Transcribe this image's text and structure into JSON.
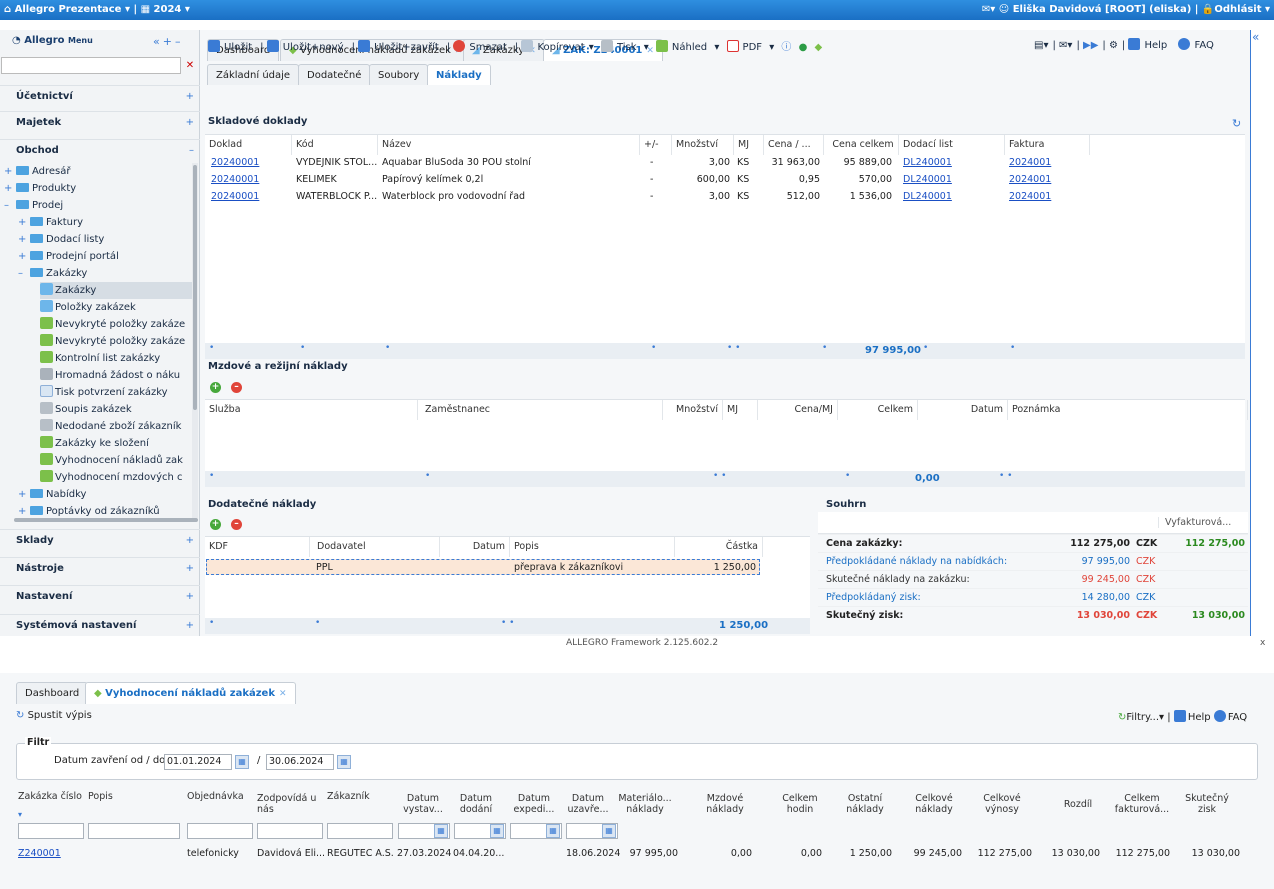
{
  "topbar": {
    "app": "Allegro Prezentace",
    "year": "2024",
    "user": "Eliška Davidová [ROOT] (eliska)",
    "logout": "Odhlásit"
  },
  "sidebar": {
    "title": "Allegro",
    "menu": "Menu",
    "sections": [
      "Účetnictví",
      "Majetek",
      "Obchod",
      "Sklady",
      "Nástroje",
      "Nastavení",
      "Systémová nastavení"
    ],
    "tree": [
      "Adresář",
      "Produkty",
      "Prodej",
      "Faktury",
      "Dodací listy",
      "Prodejní portál",
      "Zakázky",
      "Zakázky",
      "Položky zakázek",
      "Nevykryté položky zakáze",
      "Nevykryté položky zakáze",
      "Kontrolní list zakázky",
      "Hromadná žádost o náku",
      "Tisk potvrzení zakázky",
      "Soupis zakázek",
      "Nedodané zboží zákazník",
      "Zakázky ke složení",
      "Vyhodnocení nákladů zak",
      "Vyhodnocení mzdových c",
      "Nabídky",
      "Poptávky od zákazníků"
    ]
  },
  "tabs": {
    "t1": "Dashboard",
    "t2": "Vyhodnocení nákladů zakázek",
    "t3": "Zakázky",
    "t4": "ZAK: Z240001"
  },
  "toolbar": {
    "save": "Uložit",
    "save_new": "Uložit+nový",
    "save_close": "Uložit+zavřít",
    "delete": "Smazat",
    "copy": "Kopírovat",
    "print": "Tisk",
    "preview": "Náhled",
    "pdf": "PDF",
    "help": "Help",
    "faq": "FAQ"
  },
  "subtabs": [
    "Základní údaje",
    "Dodatečné",
    "Soubory",
    "Náklady"
  ],
  "stock": {
    "title": "Skladové doklady",
    "headers": [
      "Doklad",
      "Kód",
      "Název",
      "+/-",
      "Množství",
      "MJ",
      "Cena / ...",
      "Cena celkem",
      "Dodací list",
      "Faktura"
    ],
    "rows": [
      [
        "20240001",
        "VYDEJNIK STOL...",
        "Aquabar BluSoda 30 POU stolní",
        "-",
        "3,00",
        "KS",
        "31 963,00",
        "95 889,00",
        "DL240001",
        "2024001"
      ],
      [
        "20240001",
        "KELIMEK",
        "Papírový kelímek 0,2l",
        "-",
        "600,00",
        "KS",
        "0,95",
        "570,00",
        "DL240001",
        "2024001"
      ],
      [
        "20240001",
        "WATERBLOCK P...",
        "Waterblock pro vodovodní řad",
        "-",
        "3,00",
        "KS",
        "512,00",
        "1 536,00",
        "DL240001",
        "2024001"
      ]
    ],
    "total": "97 995,00"
  },
  "wage": {
    "title": "Mzdové a režijní náklady",
    "headers": [
      "Služba",
      "Zaměstnanec",
      "Množství",
      "MJ",
      "Cena/MJ",
      "Celkem",
      "Datum",
      "Poznámka"
    ],
    "total": "0,00"
  },
  "extra": {
    "title": "Dodatečné náklady",
    "headers": [
      "KDF",
      "Dodavatel",
      "Datum",
      "Popis",
      "Částka"
    ],
    "row": [
      "PPL",
      "přeprava k zákazníkovi",
      "1 250,00"
    ],
    "total": "1 250,00"
  },
  "summary": {
    "title": "Souhrn",
    "col": "Vyfakturová...",
    "rows": [
      [
        "Cena zakázky:",
        "112 275,00",
        "CZK",
        "112 275,00"
      ],
      [
        "Předpokládané náklady na nabídkách:",
        "97 995,00",
        "CZK",
        ""
      ],
      [
        "Skutečné náklady na zakázku:",
        "99 245,00",
        "CZK",
        ""
      ],
      [
        "Předpokládaný zisk:",
        "14 280,00",
        "CZK",
        ""
      ],
      [
        "Skutečný zisk:",
        "13 030,00",
        "CZK",
        "13 030,00"
      ]
    ]
  },
  "footer": "ALLEGRO Framework 2.125.602.2",
  "close": "x",
  "lower": {
    "tabs": [
      "Dashboard",
      "Vyhodnocení nákladů zakázek"
    ],
    "run": "Spustit výpis",
    "filters": "Filtry...",
    "help": "Help",
    "faq": "FAQ",
    "filter_title": "Filtr",
    "date_label": "Datum zavření od / do:",
    "from": "01.01.2024",
    "to": "30.06.2024",
    "sep": "/",
    "headers": [
      "Zakázka číslo",
      "Popis",
      "Objednávka",
      "Zodpovídá u nás",
      "Zákazník",
      "Datum vystav...",
      "Datum dodání",
      "Datum expedi...",
      "Datum uzavře...",
      "Materiálo... náklady",
      "Mzdové náklady",
      "Celkem hodin",
      "Ostatní náklady",
      "Celkové náklady",
      "Celkové výnosy",
      "Rozdíl",
      "Celkem fakturová...",
      "Skutečný zisk"
    ],
    "row": [
      "Z240001",
      "",
      "telefonicky",
      "Davidová Eli...",
      "REGUTEC A.S.",
      "27.03.2024",
      "04.04.20...",
      "",
      "18.06.2024",
      "97 995,00",
      "0,00",
      "0,00",
      "1 250,00",
      "99 245,00",
      "112 275,00",
      "13 030,00",
      "112 275,00",
      "13 030,00"
    ]
  }
}
